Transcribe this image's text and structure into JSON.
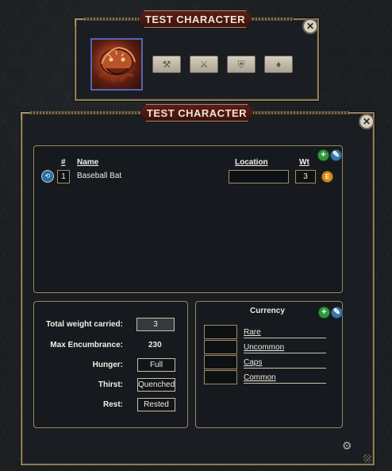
{
  "top_window": {
    "title": "TEST CHARACTER",
    "tool_buttons": [
      {
        "icon": "crossed-tools-icon",
        "glyph": "⚒"
      },
      {
        "icon": "crossed-swords-icon",
        "glyph": "⚔"
      },
      {
        "icon": "shield-icon",
        "glyph": "⛨"
      },
      {
        "icon": "pouch-icon",
        "glyph": "♦"
      }
    ]
  },
  "main_window": {
    "title": "TEST CHARACTER",
    "inventory": {
      "headers": {
        "num": "#",
        "name": "Name",
        "location": "Location",
        "wt": "Wt"
      },
      "items": [
        {
          "count": "1",
          "name": "Baseball Bat",
          "location": "",
          "weight": "3",
          "equip_badge": "E"
        }
      ]
    },
    "stats": {
      "total_weight_label": "Total weight carried:",
      "total_weight_value": "3",
      "max_encumbrance_label": "Max Encumbrance:",
      "max_encumbrance_value": "230",
      "hunger_label": "Hunger:",
      "hunger_value": "Full",
      "thirst_label": "Thirst:",
      "thirst_value": "Quenched",
      "rest_label": "Rest:",
      "rest_value": "Rested"
    },
    "currency": {
      "title": "Currency",
      "rows": [
        {
          "amount": "",
          "name": "Rare"
        },
        {
          "amount": "",
          "name": "Uncommon"
        },
        {
          "amount": "",
          "name": "Caps"
        },
        {
          "amount": "",
          "name": "Common"
        }
      ]
    }
  },
  "colors": {
    "frame": "#8d7b5a",
    "title_plate": "#5b1e16",
    "add_button": "#2f9a3b",
    "edit_button": "#3877a8",
    "equip_badge": "#d98b1c"
  }
}
